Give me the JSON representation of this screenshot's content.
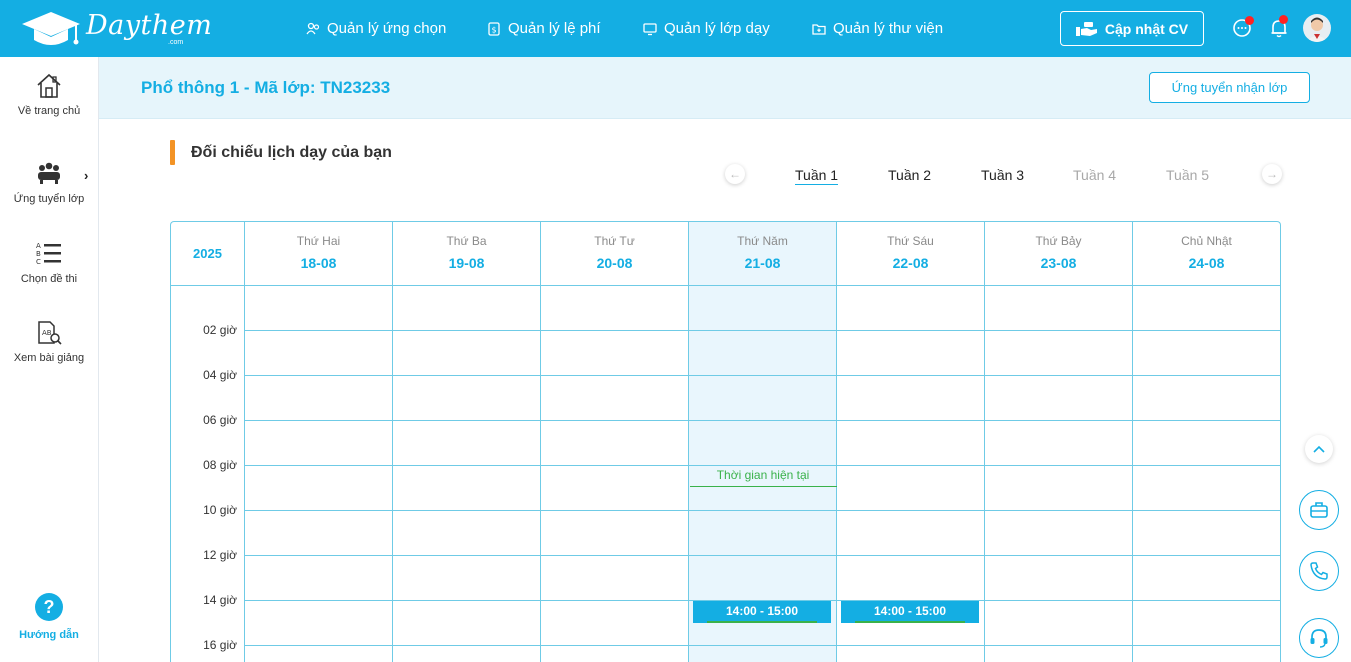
{
  "brand": {
    "name": "Daythem",
    "sub": ".com"
  },
  "nav": [
    {
      "label": "Quản lý ứng chọn",
      "icon": "users-icon"
    },
    {
      "label": "Quản lý lệ phí",
      "icon": "fee-icon"
    },
    {
      "label": "Quản lý lớp dạy",
      "icon": "monitor-icon"
    },
    {
      "label": "Quản lý thư viện",
      "icon": "folder-icon"
    }
  ],
  "header": {
    "cv_button": "Cập nhật CV"
  },
  "sidebar": {
    "items": [
      {
        "label": "Về trang chủ",
        "icon": "home-icon"
      },
      {
        "label": "Ứng tuyển lớp",
        "icon": "group-icon"
      },
      {
        "label": "Chọn đề thi",
        "icon": "abc-list-icon"
      },
      {
        "label": "Xem bài giảng",
        "icon": "doc-search-icon"
      }
    ],
    "help": {
      "symbol": "?",
      "label": "Hướng dẫn"
    }
  },
  "page": {
    "title": "Phổ thông 1 - Mã lớp: TN23233",
    "apply_button": "Ứng tuyển nhận lớp",
    "section_title": "Đối chiếu lịch dạy của bạn"
  },
  "weeks": [
    {
      "label": "Tuần 1",
      "state": "active"
    },
    {
      "label": "Tuần 2",
      "state": "normal"
    },
    {
      "label": "Tuần 3",
      "state": "normal"
    },
    {
      "label": "Tuần 4",
      "state": "disabled"
    },
    {
      "label": "Tuần 5",
      "state": "disabled"
    }
  ],
  "calendar": {
    "year": "2025",
    "days": [
      {
        "name": "Thứ Hai",
        "date": "18-08"
      },
      {
        "name": "Thứ Ba",
        "date": "19-08"
      },
      {
        "name": "Thứ Tư",
        "date": "20-08"
      },
      {
        "name": "Thứ Năm",
        "date": "21-08",
        "today": true
      },
      {
        "name": "Thứ Sáu",
        "date": "22-08"
      },
      {
        "name": "Thứ Bảy",
        "date": "23-08"
      },
      {
        "name": "Chủ Nhật",
        "date": "24-08"
      }
    ],
    "hours": [
      "02 giờ",
      "04 giờ",
      "06 giờ",
      "08 giờ",
      "10 giờ",
      "12 giờ",
      "14 giờ",
      "16 giờ"
    ],
    "now_label": "Thời gian hiện tại",
    "events": [
      {
        "day_index": 3,
        "time": "14:00 - 15:00"
      },
      {
        "day_index": 4,
        "time": "14:00 - 15:00"
      }
    ]
  },
  "colors": {
    "primary": "#14aee3",
    "accent": "#f39325",
    "now": "#3ab24a",
    "alert": "#ff2222"
  }
}
